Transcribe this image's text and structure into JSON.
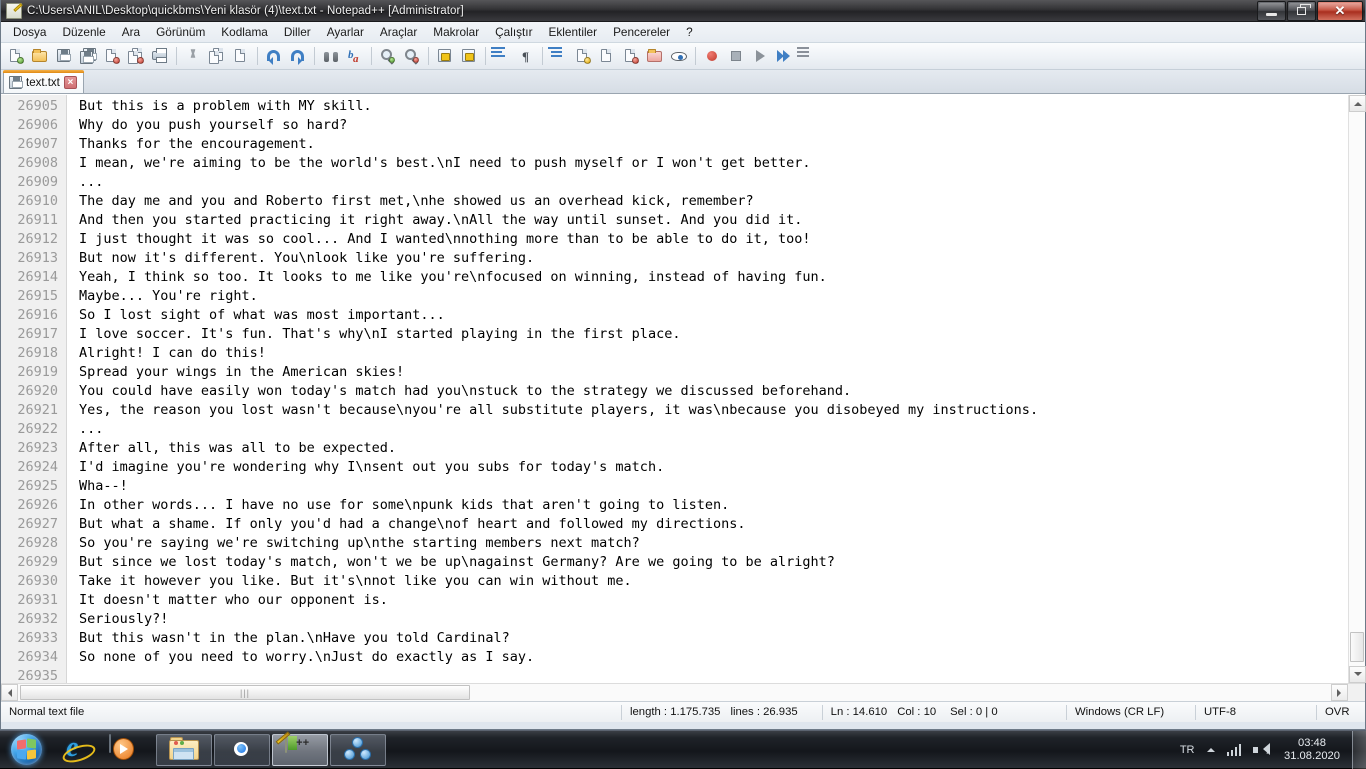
{
  "window": {
    "title": "C:\\Users\\ANIL\\Desktop\\quickbms\\Yeni klasör (4)\\text.txt - Notepad++ [Administrator]",
    "icon": "notepad-plus-plus-icon",
    "buttons": {
      "minimize": "minimize-button",
      "maximize": "maximize-button",
      "close": "close-button"
    }
  },
  "menu": {
    "items": [
      {
        "label": "Dosya"
      },
      {
        "label": "Düzenle"
      },
      {
        "label": "Ara"
      },
      {
        "label": "Görünüm"
      },
      {
        "label": "Kodlama"
      },
      {
        "label": "Diller"
      },
      {
        "label": "Ayarlar"
      },
      {
        "label": "Araçlar"
      },
      {
        "label": "Makrolar"
      },
      {
        "label": "Çalıştır"
      },
      {
        "label": "Eklentiler"
      },
      {
        "label": "Pencereler"
      }
    ],
    "help_label": "?"
  },
  "toolbar": {
    "icons": [
      "new-file-icon",
      "open-file-icon",
      "save-icon",
      "save-all-icon",
      "close-file-icon",
      "close-all-icon",
      "print-icon",
      "cut-icon",
      "copy-icon",
      "paste-icon",
      "undo-icon",
      "redo-icon",
      "find-icon",
      "replace-icon",
      "zoom-in-icon",
      "zoom-out-icon",
      "sync-vertical-scroll-icon",
      "sync-horizontal-scroll-icon",
      "word-wrap-icon",
      "show-all-characters-icon",
      "indent-guide-icon",
      "user-defined-dialog-icon",
      "document-map-icon",
      "function-list-icon",
      "folder-as-workspace-icon",
      "monitoring-icon",
      "record-macro-icon",
      "stop-recording-icon",
      "play-macro-icon",
      "run-macro-multiple-icon",
      "run-icon"
    ]
  },
  "tabs": [
    {
      "label": "text.txt",
      "icon": "saved-file-icon",
      "close": "×",
      "active": true
    }
  ],
  "editor": {
    "first_line_number": 26905,
    "lines": [
      {
        "n": "26905",
        "text": "But this is a problem with MY skill."
      },
      {
        "n": "26906",
        "text": "Why do you push yourself so hard?"
      },
      {
        "n": "26907",
        "text": "Thanks for the encouragement."
      },
      {
        "n": "26908",
        "text": "I mean, we're aiming to be the world's best.\\nI need to push myself or I won't get better."
      },
      {
        "n": "26909",
        "text": "..."
      },
      {
        "n": "26910",
        "text": "The day me and you and Roberto first met,\\nhe showed us an overhead kick, remember?"
      },
      {
        "n": "26911",
        "text": "And then you started practicing it right away.\\nAll the way until sunset. And you did it."
      },
      {
        "n": "26912",
        "text": "I just thought it was so cool... And I wanted\\nnothing more than to be able to do it, too!"
      },
      {
        "n": "26913",
        "text": "But now it's different. You\\nlook like you're suffering."
      },
      {
        "n": "26914",
        "text": "Yeah, I think so too. It looks to me like you're\\nfocused on winning, instead of having fun."
      },
      {
        "n": "26915",
        "text": "Maybe... You're right."
      },
      {
        "n": "26916",
        "text": "So I lost sight of what was most important..."
      },
      {
        "n": "26917",
        "text": "I love soccer. It's fun. That's why\\nI started playing in the first place."
      },
      {
        "n": "26918",
        "text": "Alright! I can do this!"
      },
      {
        "n": "26919",
        "text": "Spread your wings in the American skies!"
      },
      {
        "n": "26920",
        "text": "You could have easily won today's match had you\\nstuck to the strategy we discussed beforehand."
      },
      {
        "n": "26921",
        "text": "Yes, the reason you lost wasn't because\\nyou're all substitute players, it was\\nbecause you disobeyed my instructions."
      },
      {
        "n": "26922",
        "text": "..."
      },
      {
        "n": "26923",
        "text": "After all, this was all to be expected."
      },
      {
        "n": "26924",
        "text": "I'd imagine you're wondering why I\\nsent out you subs for today's match."
      },
      {
        "n": "26925",
        "text": "Wha--!"
      },
      {
        "n": "26926",
        "text": "In other words... I have no use for some\\npunk kids that aren't going to listen."
      },
      {
        "n": "26927",
        "text": "But what a shame. If only you'd had a change\\nof heart and followed my directions."
      },
      {
        "n": "26928",
        "text": "So you're saying we're switching up\\nthe starting members next match?"
      },
      {
        "n": "26929",
        "text": "But since we lost today's match, won't we be up\\nagainst Germany? Are we going to be alright?"
      },
      {
        "n": "26930",
        "text": "Take it however you like. But it's\\nnot like you can win without me."
      },
      {
        "n": "26931",
        "text": "It doesn't matter who our opponent is."
      },
      {
        "n": "26932",
        "text": "Seriously?!"
      },
      {
        "n": "26933",
        "text": "But this wasn't in the plan.\\nHave you told Cardinal?"
      },
      {
        "n": "26934",
        "text": "So none of you need to worry.\\nJust do exactly as I say."
      },
      {
        "n": "26935",
        "text": ""
      }
    ]
  },
  "statusbar": {
    "file_type": "Normal text file",
    "length": "length : 1.175.735",
    "lines": "lines : 26.935",
    "ln": "Ln : 14.610",
    "col": "Col : 10",
    "sel": "Sel : 0 | 0",
    "eol": "Windows (CR LF)",
    "encoding": "UTF-8",
    "insert_mode": "OVR"
  },
  "taskbar": {
    "start": "start-orb",
    "quicklaunch": [
      {
        "name": "internet-explorer-icon"
      },
      {
        "name": "windows-media-player-icon"
      }
    ],
    "apps": [
      {
        "name": "file-explorer-icon",
        "state": "running"
      },
      {
        "name": "google-chrome-icon",
        "state": "running"
      },
      {
        "name": "notepad-plus-plus-icon",
        "state": "active"
      },
      {
        "name": "molecule-app-icon",
        "state": "running"
      }
    ],
    "tray": {
      "language": "TR",
      "show_hidden_icons": "chevron-up-icon",
      "network": "network-signal-icon",
      "volume": "speaker-icon",
      "time": "03:48",
      "date": "31.08.2020",
      "show_desktop": "show-desktop-button"
    }
  }
}
